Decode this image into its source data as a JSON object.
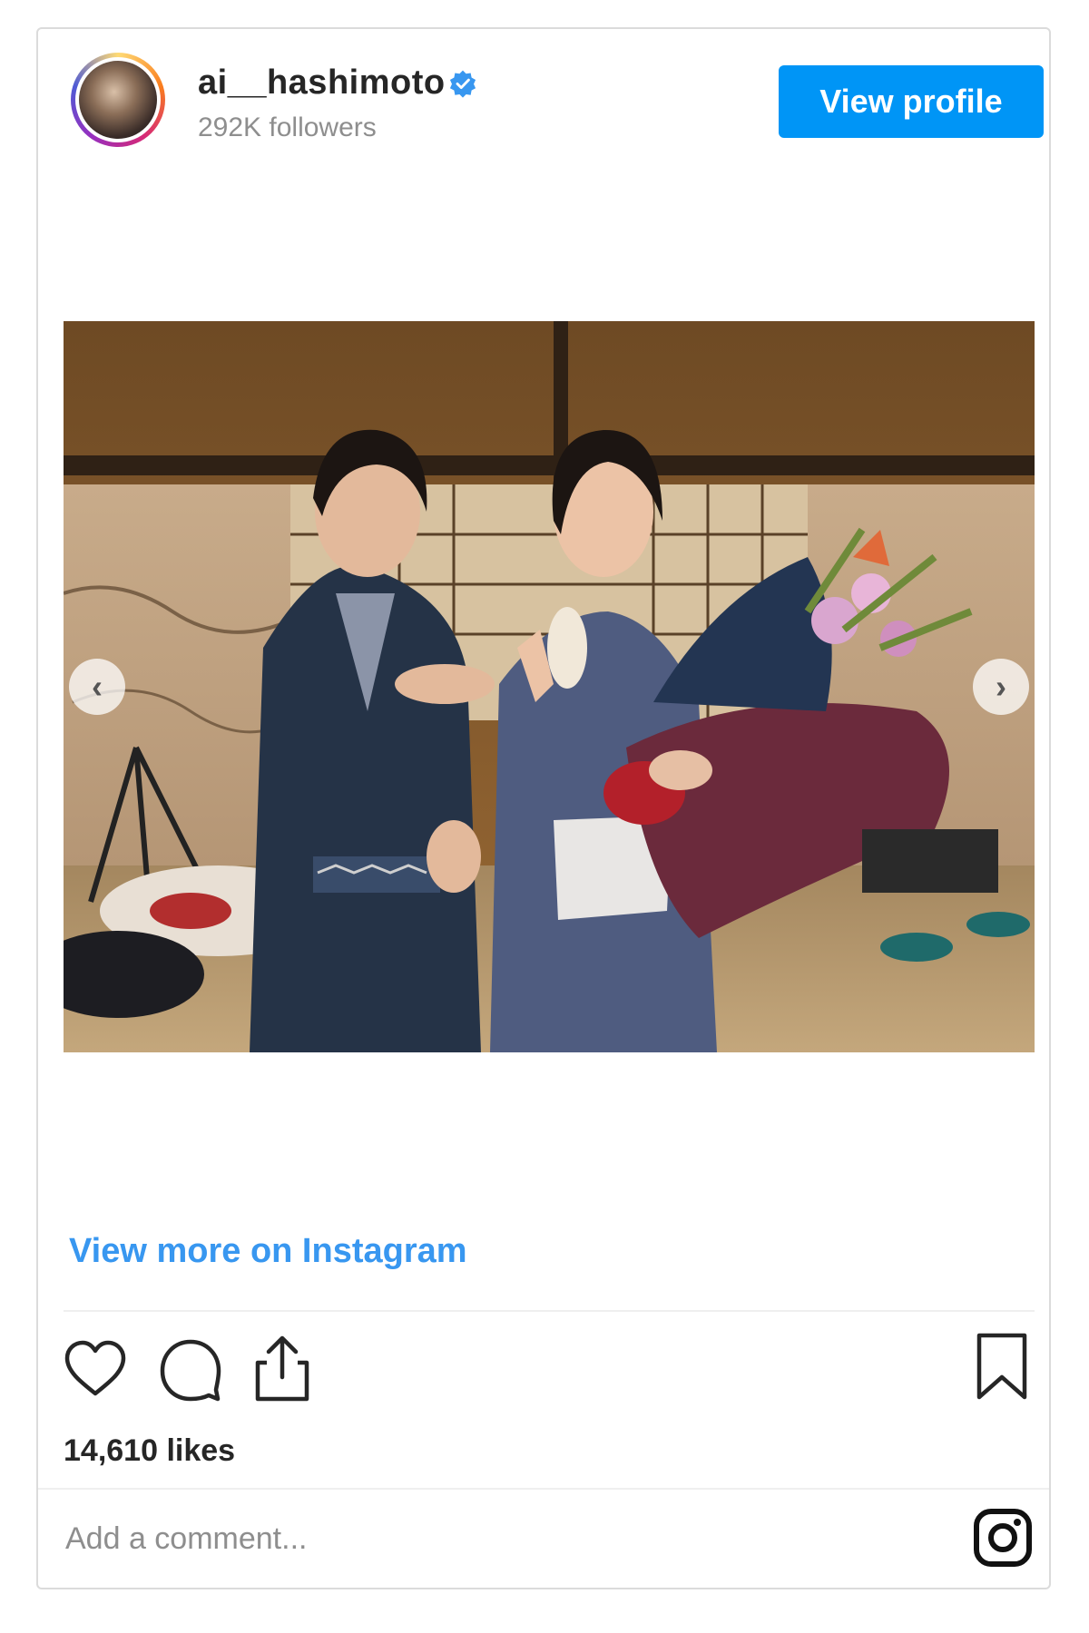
{
  "profile": {
    "username": "ai__hashimoto",
    "followers": "292K followers",
    "view_profile_label": "View profile",
    "verified": true
  },
  "media": {
    "has_prev": true,
    "has_next": true,
    "prev_glyph": "‹",
    "next_glyph": "›"
  },
  "post": {
    "view_more_label": "View more on Instagram",
    "likes": "14,610 likes",
    "comment_placeholder": "Add a comment..."
  },
  "icons": {
    "like": "heart-icon",
    "comment": "comment-icon",
    "share": "share-icon",
    "save": "bookmark-icon",
    "brand": "instagram-icon"
  },
  "colors": {
    "accent": "#0095f6",
    "link": "#3897f0",
    "verified": "#3897f0"
  }
}
